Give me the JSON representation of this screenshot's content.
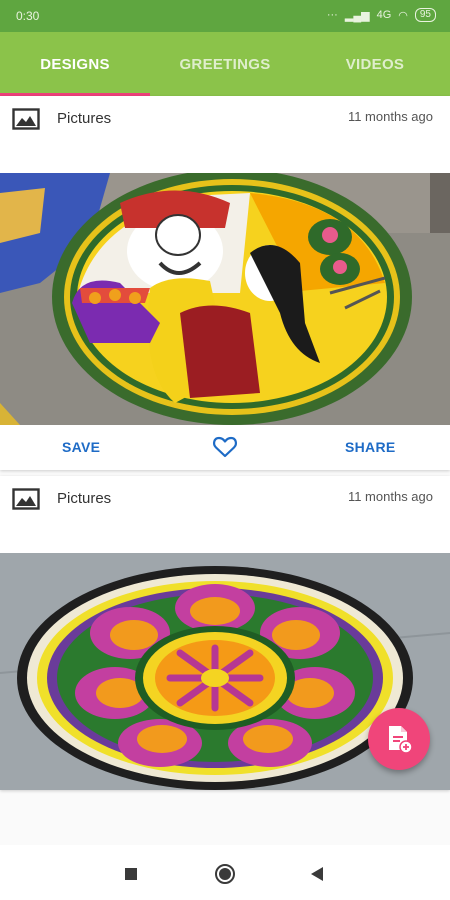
{
  "status_bar": {
    "time": "0:30",
    "network": "4G",
    "battery": "95"
  },
  "tabs": [
    {
      "label": "DESIGNS",
      "active": true
    },
    {
      "label": "GREETINGS",
      "active": false
    },
    {
      "label": "VIDEOS",
      "active": false
    }
  ],
  "posts": [
    {
      "category": "Pictures",
      "time": "11 months ago",
      "save_label": "SAVE",
      "share_label": "SHARE",
      "image": "kathakali-flower-rangoli"
    },
    {
      "category": "Pictures",
      "time": "11 months ago",
      "image": "floral-mandala-rangoli"
    }
  ],
  "colors": {
    "tab_bar": "#8bc34a",
    "status_bar": "#5fa640",
    "accent": "#ec407a",
    "action": "#1e6bc6",
    "fab": "#f0457a"
  },
  "icons": {
    "category": "image-icon",
    "like": "heart-outline-icon",
    "fab": "document-add-icon",
    "nav": [
      "square-icon",
      "circle-icon",
      "back-triangle-icon"
    ]
  }
}
